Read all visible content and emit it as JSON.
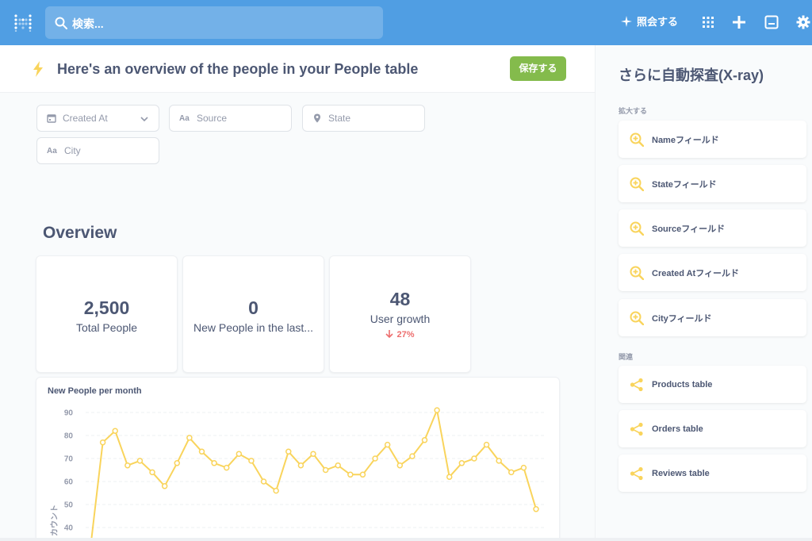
{
  "topnav": {
    "search_placeholder": "検索...",
    "ask_label": "照会する",
    "icons": [
      "grid-icon",
      "plus-icon",
      "terminal-icon",
      "gear-icon"
    ]
  },
  "header": {
    "title": "Here's an overview of the people in your People table",
    "save_label": "保存する"
  },
  "filters": [
    {
      "label": "Created At",
      "icon": "calendar-icon"
    },
    {
      "label": "Source",
      "icon": "text-field-icon"
    },
    {
      "label": "State",
      "icon": "location-pin-icon"
    },
    {
      "label": "City",
      "icon": "text-field-icon"
    }
  ],
  "overview": {
    "heading": "Overview",
    "cards": [
      {
        "value": "2,500",
        "label": "Total People"
      },
      {
        "value": "0",
        "label": "New People in the last..."
      },
      {
        "value": "48",
        "label": "User growth",
        "delta": "27%",
        "delta_direction": "down"
      }
    ]
  },
  "chart": {
    "title": "New People per month"
  },
  "chart_data": {
    "type": "line",
    "title": "New People per month",
    "ylabel": "カウント",
    "xlabel": "",
    "yticks": [
      40,
      50,
      60,
      70,
      80,
      90
    ],
    "ylim": [
      36,
      93
    ],
    "values": [
      31,
      77,
      82,
      67,
      69,
      64,
      58,
      68,
      79,
      73,
      68,
      66,
      72,
      69,
      60,
      56,
      73,
      67,
      72,
      65,
      67,
      63,
      63,
      70,
      76,
      67,
      71,
      78,
      91,
      62,
      68,
      70,
      76,
      69,
      64,
      66,
      48
    ],
    "grid": true,
    "color": "#f9d45c"
  },
  "sidebar": {
    "title": "さらに自動探査(X-ray)",
    "zoom_section": "拡大する",
    "zoom_items": [
      "Nameフィールド",
      "Stateフィールド",
      "Sourceフィールド",
      "Created Atフィールド",
      "Cityフィールド"
    ],
    "related_section": "関連",
    "related_items": [
      "Products table",
      "Orders table",
      "Reviews table"
    ]
  },
  "colors": {
    "brand": "#509ee3",
    "save": "#84bb4c",
    "accent_yellow": "#f9d45c",
    "negative": "#ed6e6e"
  }
}
